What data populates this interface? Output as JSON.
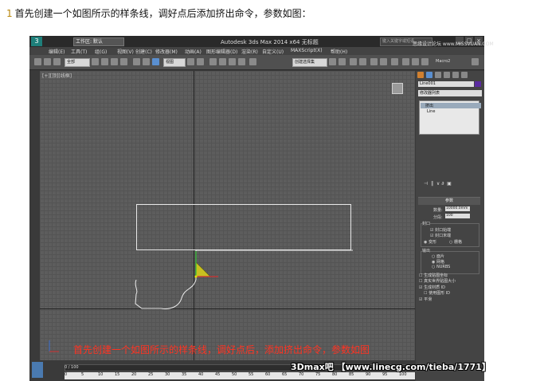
{
  "intro": {
    "number": "1",
    "text": "首先创建一个如图所示的样条线，调好点后添加挤出命令，参数如图："
  },
  "window": {
    "title": "Autodesk 3ds Max  2014 x64     无标题",
    "workspace": "工作区: 默认",
    "search_placeholder": "键入关键字或短语",
    "watermark_top": "思缘设计论坛 www.MISSVUAN.COM"
  },
  "menu": [
    "编辑(E)",
    "工具(T)",
    "组(G)",
    "视图(V)",
    "创建(C)",
    "修改器(M)",
    "动画(A)",
    "图形编辑器(D)",
    "渲染(R)",
    "自定义(U)",
    "MAXScript(X)",
    "帮助(H)"
  ],
  "toolbar": {
    "selection_filter": "全部",
    "ref_coord": "视图",
    "named_set": "创建选择集",
    "macro": "Macro2"
  },
  "viewport": {
    "label": "[+][顶][线框]"
  },
  "caption": "首先创建一个如图所示的样条线，调好点后，添加挤出命令，参数如图",
  "command_panel": {
    "object_name": "Line001",
    "modifier_list": "修改器列表",
    "stack": [
      "挤出",
      "Line"
    ],
    "params_title": "参数",
    "amount_label": "数量:",
    "amount_value": "10000.0mm",
    "segments_label": "分段:",
    "segments_value": "100",
    "cap_title": "封口",
    "cap_start": "封口始端",
    "cap_end": "封口末端",
    "morph": "变形",
    "grid": "栅格",
    "output_title": "输出",
    "out_patch": "面片",
    "out_mesh": "网格",
    "out_nurbs": "NURBS",
    "gen_mapping": "生成贴图坐标",
    "real_world": "真实世界贴图大小",
    "gen_mat_ids": "生成材质 ID",
    "use_shape_ids": "使用图形 ID",
    "smooth": "平滑"
  },
  "timeline": {
    "progress_text": "0 / 100",
    "progress": 0,
    "ticks": [
      "0",
      "5",
      "10",
      "15",
      "20",
      "25",
      "30",
      "35",
      "40",
      "45",
      "50",
      "55",
      "60",
      "65",
      "70",
      "75",
      "80",
      "85",
      "90",
      "95",
      "100"
    ]
  },
  "watermark": "3Dmax吧 【www.linecg.com/tieba/1771】"
}
